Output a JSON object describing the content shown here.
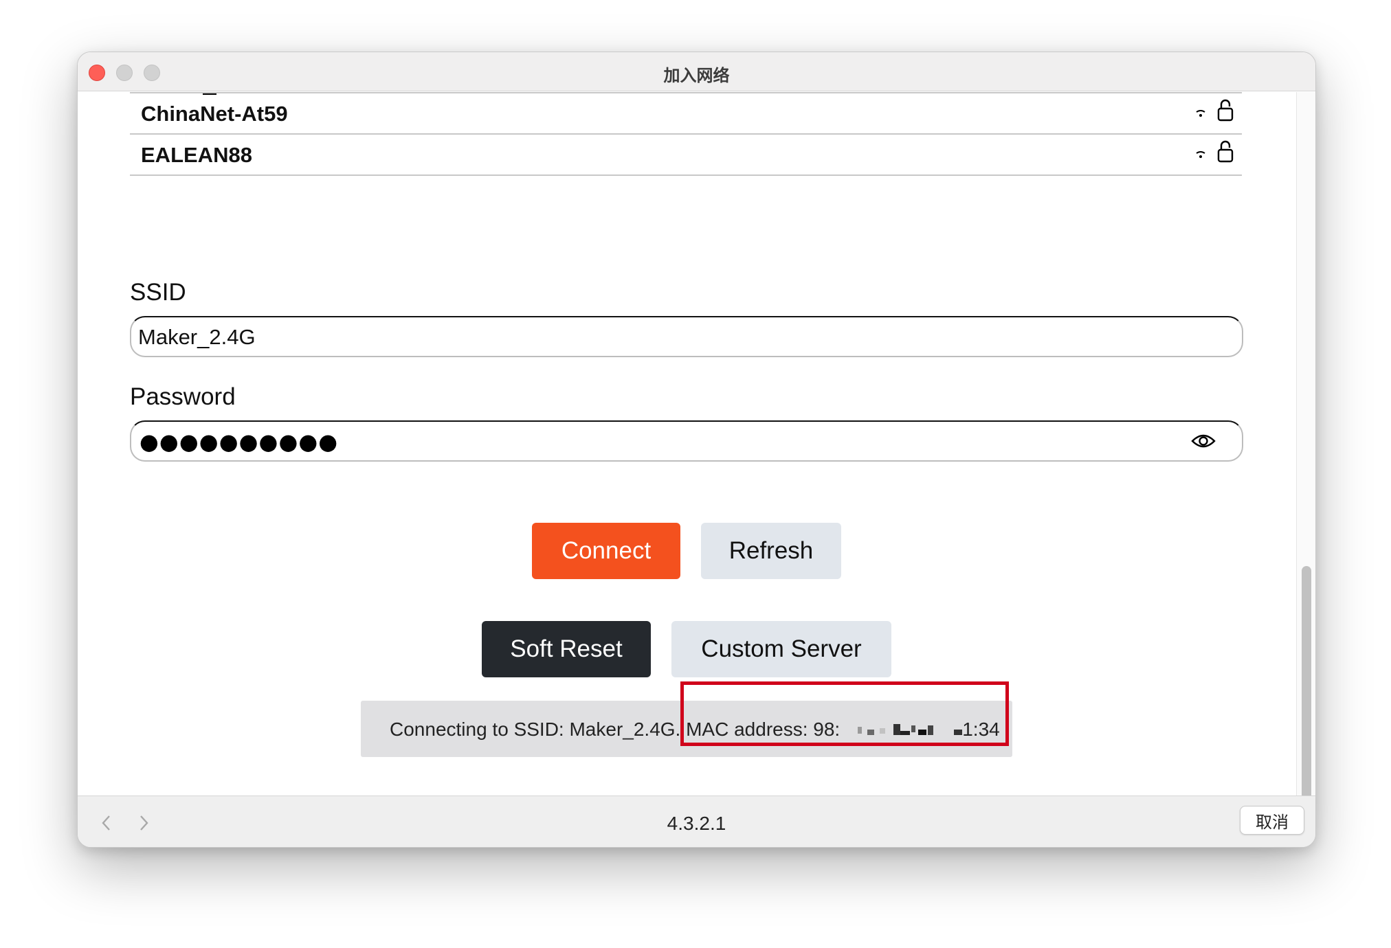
{
  "window": {
    "title": "加入网络"
  },
  "networks": [
    {
      "name": "ChinaNet-At59",
      "secured": true,
      "signal_icon": "wifi-icon"
    },
    {
      "name": "EALEAN88",
      "secured": true,
      "signal_icon": "wifi-icon"
    }
  ],
  "form": {
    "ssid_label": "SSID",
    "ssid_value": "Maker_2.4G",
    "password_label": "Password",
    "password_masked": "●●●●●●●●●●"
  },
  "buttons": {
    "connect": "Connect",
    "refresh": "Refresh",
    "soft_reset": "Soft Reset",
    "custom_server": "Custom Server"
  },
  "status": {
    "text_prefix": "Connecting to SSID: Maker_2.4G.",
    "mac_label": "MAC address: 98:",
    "mac_suffix": "1:34"
  },
  "footer": {
    "version": "4.3.2.1",
    "cancel": "取消"
  },
  "colors": {
    "connect": "#f4511e",
    "soft_reset": "#25292e",
    "secondary": "#e1e6ec",
    "highlight": "#d0021b"
  }
}
